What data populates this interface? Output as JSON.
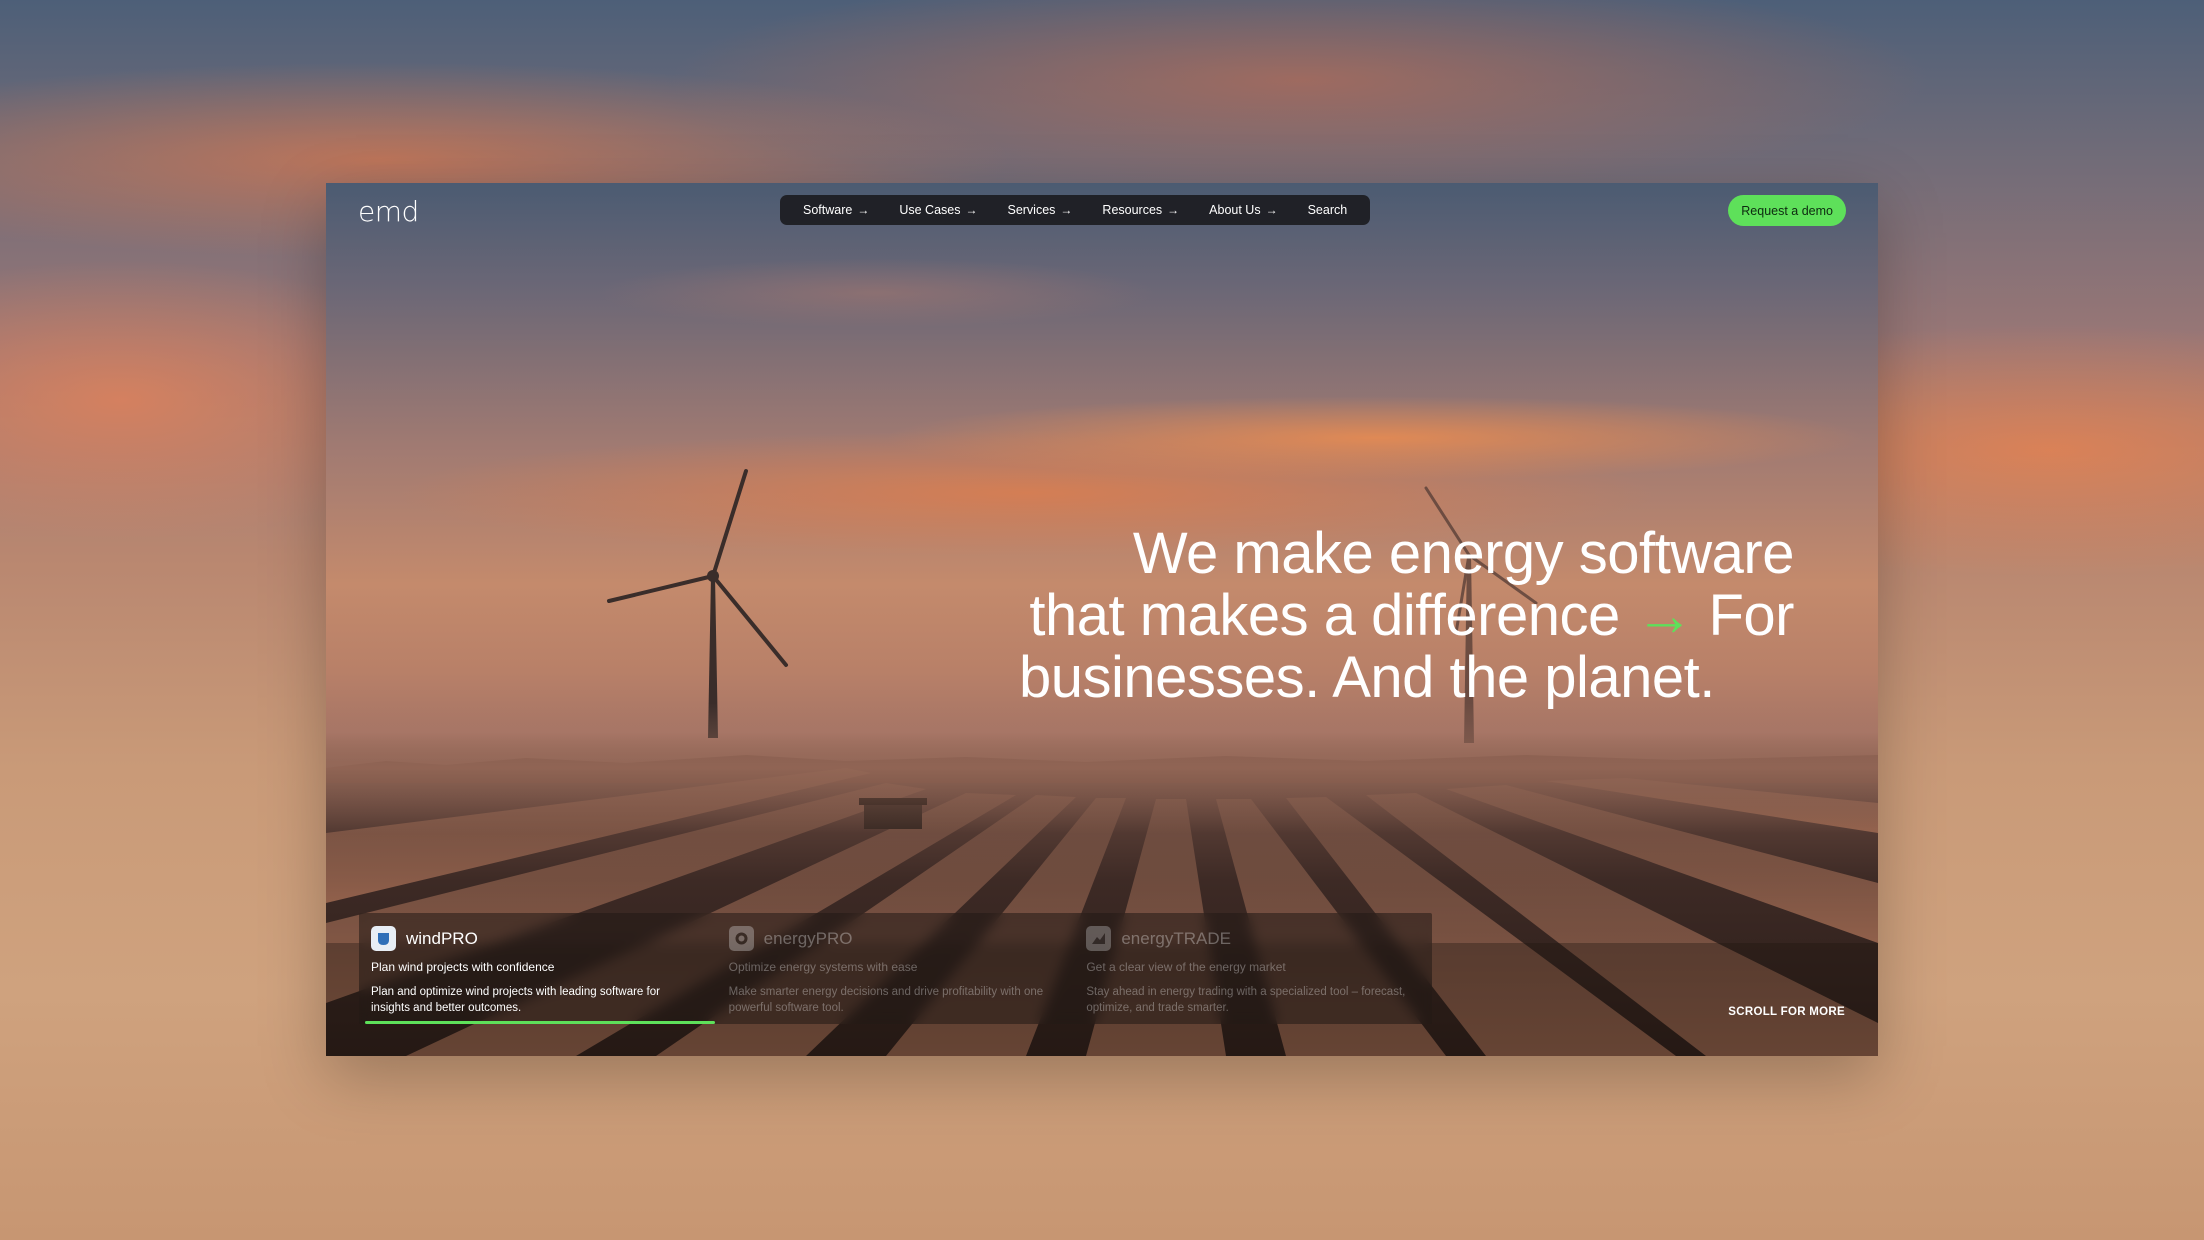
{
  "brand": {
    "logo_text": "emd"
  },
  "nav": {
    "items": [
      {
        "label": "Software",
        "arrow": "→"
      },
      {
        "label": "Use Cases",
        "arrow": "→"
      },
      {
        "label": "Services",
        "arrow": "→"
      },
      {
        "label": "Resources",
        "arrow": "→"
      },
      {
        "label": "About Us",
        "arrow": "→"
      },
      {
        "label": "Search",
        "arrow": ""
      }
    ],
    "cta_label": "Request a demo"
  },
  "hero": {
    "line1": "We make energy software",
    "line2": "that makes a difference",
    "arrow": "→",
    "line2_end": "For",
    "line3": "businesses. And the planet."
  },
  "products": [
    {
      "name": "windPRO",
      "tagline": "Plan wind projects with confidence",
      "description": "Plan and optimize wind projects with leading software for insights and better outcomes.",
      "icon": "windpro-icon",
      "active": true
    },
    {
      "name": "energyPRO",
      "tagline": "Optimize energy systems with ease",
      "description": "Make smarter energy decisions and drive profitability with one powerful software tool.",
      "icon": "energypro-icon",
      "active": false
    },
    {
      "name": "energyTRADE",
      "tagline": "Get a clear view of the energy market",
      "description": "Stay ahead in energy trading with a specialized tool – forecast, optimize, and trade smarter.",
      "icon": "energytrade-icon",
      "active": false
    }
  ],
  "scroll_hint": "SCROLL FOR MORE",
  "colors": {
    "accent": "#5ee05a",
    "nav_bg": "#19191c"
  }
}
